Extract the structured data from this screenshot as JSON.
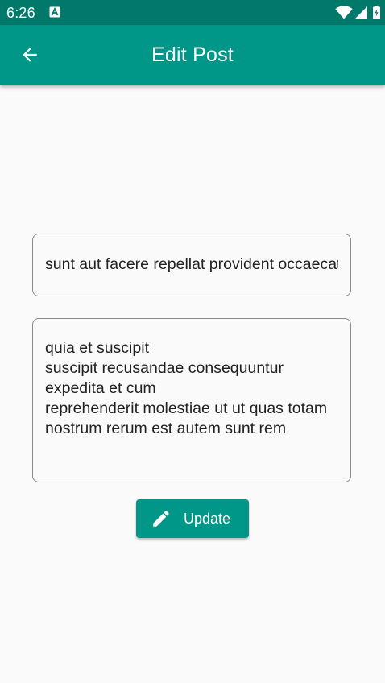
{
  "status_bar": {
    "time": "6:26",
    "icons": [
      "a-badge-icon",
      "wifi-icon",
      "cell-signal-icon",
      "battery-icon"
    ]
  },
  "app_bar": {
    "title": "Edit Post",
    "back_icon": "arrow-back-icon",
    "color": "#009688",
    "status_color": "#00796b"
  },
  "form": {
    "title_value": "sunt aut facere repellat provident occaecati excepturi optio reprehenderit",
    "body_value": "quia et suscipit\nsuscipit recusandae consequuntur expedita et cum\nreprehenderit molestiae ut ut quas totam\nnostrum rerum est autem sunt rem"
  },
  "actions": {
    "update_label": "Update",
    "update_icon": "edit-pencil-icon"
  }
}
